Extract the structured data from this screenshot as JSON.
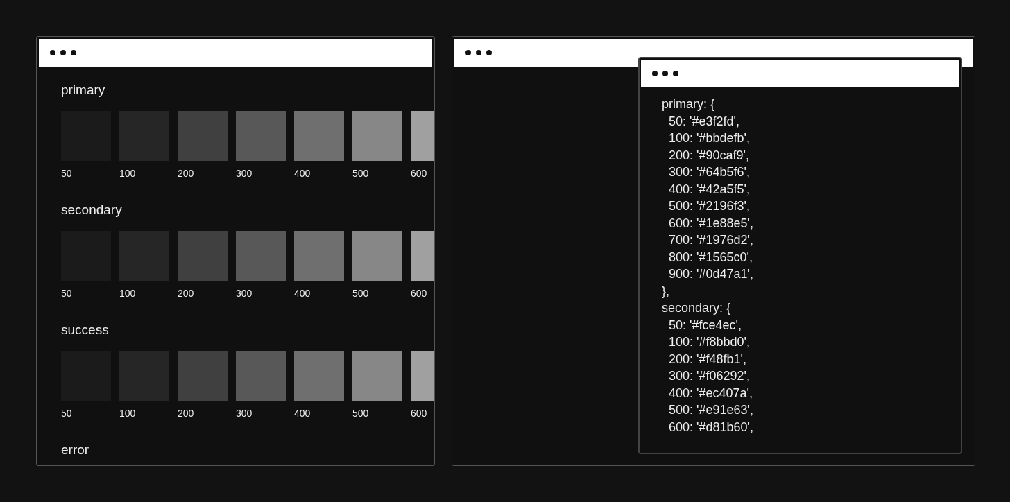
{
  "palette_window": {
    "palettes": [
      {
        "name": "primary",
        "swatches": [
          {
            "label": "50",
            "color": "#1b1b1b"
          },
          {
            "label": "100",
            "color": "#262626"
          },
          {
            "label": "200",
            "color": "#404040"
          },
          {
            "label": "300",
            "color": "#585858"
          },
          {
            "label": "400",
            "color": "#6f6f6f"
          },
          {
            "label": "500",
            "color": "#878787"
          },
          {
            "label": "600",
            "color": "#a0a0a0"
          }
        ]
      },
      {
        "name": "secondary",
        "swatches": [
          {
            "label": "50",
            "color": "#1b1b1b"
          },
          {
            "label": "100",
            "color": "#262626"
          },
          {
            "label": "200",
            "color": "#404040"
          },
          {
            "label": "300",
            "color": "#585858"
          },
          {
            "label": "400",
            "color": "#6f6f6f"
          },
          {
            "label": "500",
            "color": "#878787"
          },
          {
            "label": "600",
            "color": "#a0a0a0"
          }
        ]
      },
      {
        "name": "success",
        "swatches": [
          {
            "label": "50",
            "color": "#1b1b1b"
          },
          {
            "label": "100",
            "color": "#262626"
          },
          {
            "label": "200",
            "color": "#404040"
          },
          {
            "label": "300",
            "color": "#585858"
          },
          {
            "label": "400",
            "color": "#6f6f6f"
          },
          {
            "label": "500",
            "color": "#878787"
          },
          {
            "label": "600",
            "color": "#a0a0a0"
          }
        ]
      },
      {
        "name": "error"
      }
    ]
  },
  "code_window": {
    "lines": [
      {
        "kind": "open",
        "text": "primary: {"
      },
      {
        "kind": "entry",
        "text": "50: '#e3f2fd',"
      },
      {
        "kind": "entry",
        "text": "100: '#bbdefb',"
      },
      {
        "kind": "entry",
        "text": "200: '#90caf9',"
      },
      {
        "kind": "entry",
        "text": "300: '#64b5f6',"
      },
      {
        "kind": "entry",
        "text": "400: '#42a5f5',"
      },
      {
        "kind": "entry",
        "text": "500: '#2196f3',"
      },
      {
        "kind": "entry",
        "text": "600: '#1e88e5',"
      },
      {
        "kind": "entry",
        "text": "700: '#1976d2',"
      },
      {
        "kind": "entry",
        "text": "800: '#1565c0',"
      },
      {
        "kind": "entry",
        "text": "900: '#0d47a1',"
      },
      {
        "kind": "close",
        "text": "},"
      },
      {
        "kind": "open",
        "text": "secondary: {"
      },
      {
        "kind": "entry",
        "text": "50: '#fce4ec',"
      },
      {
        "kind": "entry",
        "text": "100: '#f8bbd0',"
      },
      {
        "kind": "entry",
        "text": "200: '#f48fb1',"
      },
      {
        "kind": "entry",
        "text": "300: '#f06292',"
      },
      {
        "kind": "entry",
        "text": "400: '#ec407a',"
      },
      {
        "kind": "entry",
        "text": "500: '#e91e63',"
      },
      {
        "kind": "entry",
        "text": "600: '#d81b60',"
      }
    ]
  }
}
